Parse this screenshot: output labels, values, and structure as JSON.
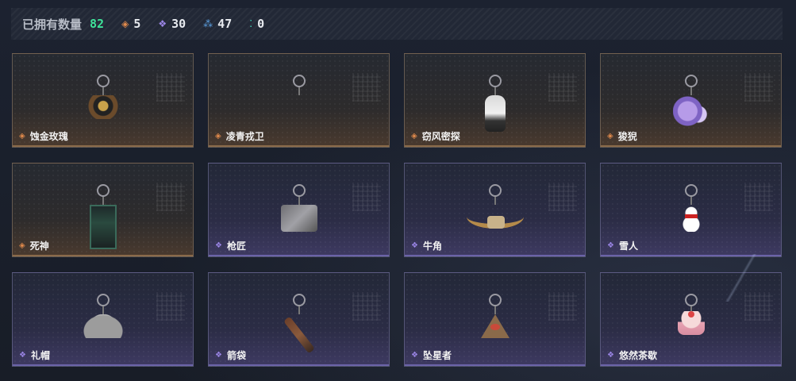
{
  "header": {
    "owned_label": "已拥有数量",
    "owned_count": "82",
    "stats": [
      {
        "icon": "orange-diamond-icon",
        "symbol": "◈",
        "color": "#e08a4c",
        "value": "5"
      },
      {
        "icon": "purple-cluster-icon",
        "symbol": "❖",
        "color": "#9b86e6",
        "value": "30"
      },
      {
        "icon": "blue-cluster-icon",
        "symbol": "⁂",
        "color": "#5b9fe0",
        "value": "47"
      },
      {
        "icon": "teal-dots-icon",
        "symbol": "⁚",
        "color": "#3fe0c2",
        "value": "0"
      }
    ]
  },
  "items": [
    {
      "name": "蚀金玫瑰",
      "rarity": "orange",
      "charm": "c-rose"
    },
    {
      "name": "凌青戎卫",
      "rarity": "orange",
      "charm": "c-gray"
    },
    {
      "name": "窃风密探",
      "rarity": "orange",
      "charm": "c-white"
    },
    {
      "name": "狻猊",
      "rarity": "orange",
      "charm": "c-purple"
    },
    {
      "name": "死神",
      "rarity": "orange",
      "charm": "c-reaper"
    },
    {
      "name": "枪匠",
      "rarity": "purple",
      "charm": "c-dog"
    },
    {
      "name": "牛角",
      "rarity": "purple",
      "charm": "c-horn"
    },
    {
      "name": "雪人",
      "rarity": "purple",
      "charm": "c-snow"
    },
    {
      "name": "礼帽",
      "rarity": "purple",
      "charm": "c-hat"
    },
    {
      "name": "箭袋",
      "rarity": "purple",
      "charm": "c-quiver"
    },
    {
      "name": "坠星者",
      "rarity": "purple",
      "charm": "c-tri"
    },
    {
      "name": "悠然茶歇",
      "rarity": "purple",
      "charm": "c-cake"
    }
  ],
  "rarity_symbols": {
    "orange": "◈",
    "purple": "❖"
  },
  "colors": {
    "orange_accent": "#e08a4c",
    "purple_accent": "#9b86e6",
    "owned_green": "#3fe39a"
  }
}
